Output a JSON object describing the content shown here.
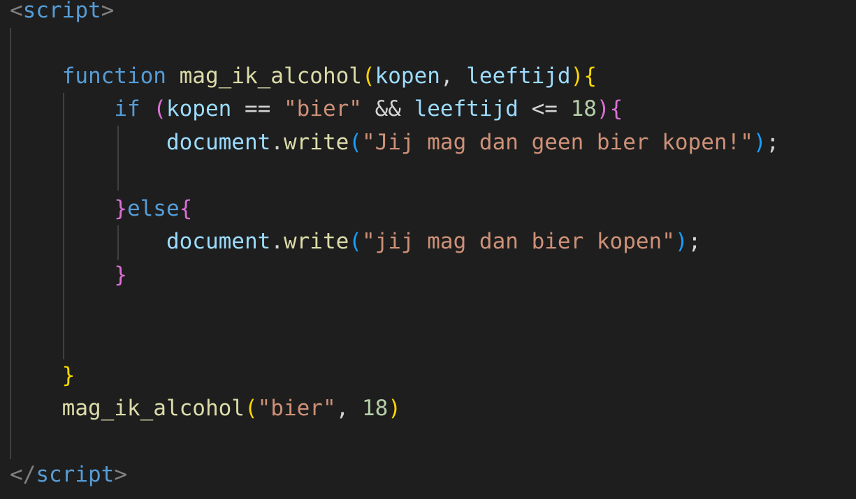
{
  "editor": {
    "line1": {
      "lt": "<",
      "tag": "script",
      "gt": ">"
    },
    "line3": {
      "indent": "    ",
      "keyword": "function",
      "sp1": " ",
      "name": "mag_ik_alcohol",
      "open": "(",
      "param1": "kopen",
      "comma": ", ",
      "param2": "leeftijd",
      "close": ")",
      "brace": "{"
    },
    "line4": {
      "indent": "        ",
      "keyword": "if",
      "sp1": " ",
      "open": "(",
      "var1": "kopen",
      "op1": " == ",
      "str1": "\"bier\"",
      "op2": " && ",
      "var2": "leeftijd",
      "op3": " <= ",
      "num1": "18",
      "close": ")",
      "brace": "{"
    },
    "line5": {
      "indent": "            ",
      "object": "document",
      "dot": ".",
      "method": "write",
      "open": "(",
      "str": "\"Jij mag dan geen bier kopen!\"",
      "close": ")",
      "semi": ";"
    },
    "line7": {
      "indent": "        ",
      "brace_close": "}",
      "keyword": "else",
      "brace_open": "{"
    },
    "line8": {
      "indent": "            ",
      "object": "document",
      "dot": ".",
      "method": "write",
      "open": "(",
      "str": "\"jij mag dan bier kopen\"",
      "close": ")",
      "semi": ";"
    },
    "line9": {
      "indent": "        ",
      "brace": "}"
    },
    "line12": {
      "indent": "    ",
      "brace": "}"
    },
    "line13": {
      "indent": "    ",
      "name": "mag_ik_alcohol",
      "open": "(",
      "str": "\"bier\"",
      "comma": ", ",
      "num": "18",
      "close": ")"
    },
    "line15": {
      "lt": "</",
      "tag": "script",
      "gt": ">"
    }
  },
  "colors": {
    "background": "#1e1e1e",
    "keyword": "#569cd6",
    "function": "#dcdcaa",
    "parameter": "#9cdcfe",
    "string": "#ce9178",
    "number": "#b5cea8",
    "bracket_gold": "#ffd700",
    "bracket_orchid": "#da70d6",
    "bracket_blue": "#179fff",
    "tag_bracket": "#808080"
  }
}
